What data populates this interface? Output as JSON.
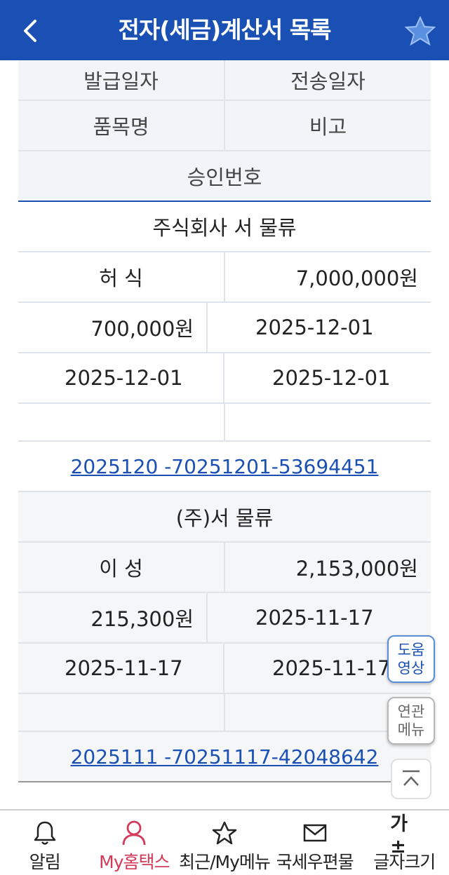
{
  "header": {
    "title": "전자(세금)계산서 목록"
  },
  "columns": {
    "issue_date": "발급일자",
    "send_date": "전송일자",
    "item_name": "품목명",
    "remark": "비고",
    "approval_no": "승인번호"
  },
  "records": [
    {
      "company": "주식회사 서  물류",
      "person": "허  식",
      "supply_amount": "7,000,000원",
      "tax_amount": "700,000원",
      "date1": "2025-12-01",
      "date2": "2025-12-01",
      "date3": "2025-12-01",
      "approval_no": "2025120  -70251201-53694451"
    },
    {
      "company": "(주)서  물류",
      "person": "이  성",
      "supply_amount": "2,153,000원",
      "tax_amount": "215,300원",
      "date1": "2025-11-17",
      "date2": "2025-11-17",
      "date3": "2025-11-17",
      "approval_no": "2025111  -70251117-42048642"
    }
  ],
  "floating": {
    "help_line1": "도움",
    "help_line2": "영상",
    "menu_line1": "연관",
    "menu_line2": "메뉴"
  },
  "tabbar": {
    "items": [
      {
        "label": "알림",
        "icon": "bell-icon"
      },
      {
        "label": "My홈택스",
        "icon": "person-icon"
      },
      {
        "label": "최근/My메뉴",
        "icon": "star-outline-icon"
      },
      {
        "label": "국세우편물",
        "icon": "mail-icon"
      },
      {
        "label": "글자크기",
        "icon": "font-size-icon",
        "glyph": "가±"
      }
    ]
  },
  "colors": {
    "primary": "#1a4fb4",
    "active_tab": "#d33a5a"
  }
}
